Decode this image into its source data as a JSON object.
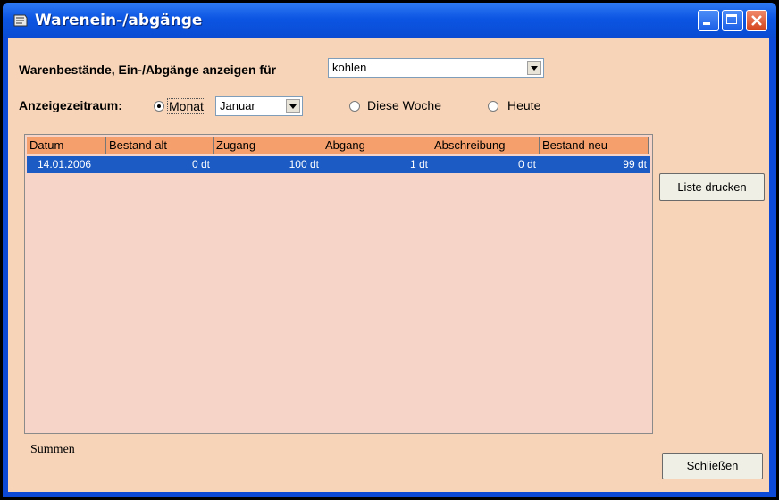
{
  "window": {
    "title": "Warenein-/abgänge"
  },
  "filter": {
    "label": "Warenbestände, Ein-/Abgänge anzeigen für",
    "product_value": "kohlen"
  },
  "period": {
    "label": "Anzeigezeitraum:",
    "option_month": "Monat",
    "month_value": "Januar",
    "option_week": "Diese Woche",
    "option_today": "Heute",
    "selected": "Monat"
  },
  "table": {
    "headers": [
      "Datum",
      "Bestand alt",
      "Zugang",
      "Abgang",
      "Abschreibung",
      "Bestand neu"
    ],
    "rows": [
      [
        "14.01.2006",
        "0 dt",
        "100 dt",
        "1 dt",
        "0 dt",
        "99 dt"
      ]
    ]
  },
  "buttons": {
    "print": "Liste drucken",
    "close": "Schließen"
  },
  "footer": {
    "sums_label": "Summen"
  }
}
